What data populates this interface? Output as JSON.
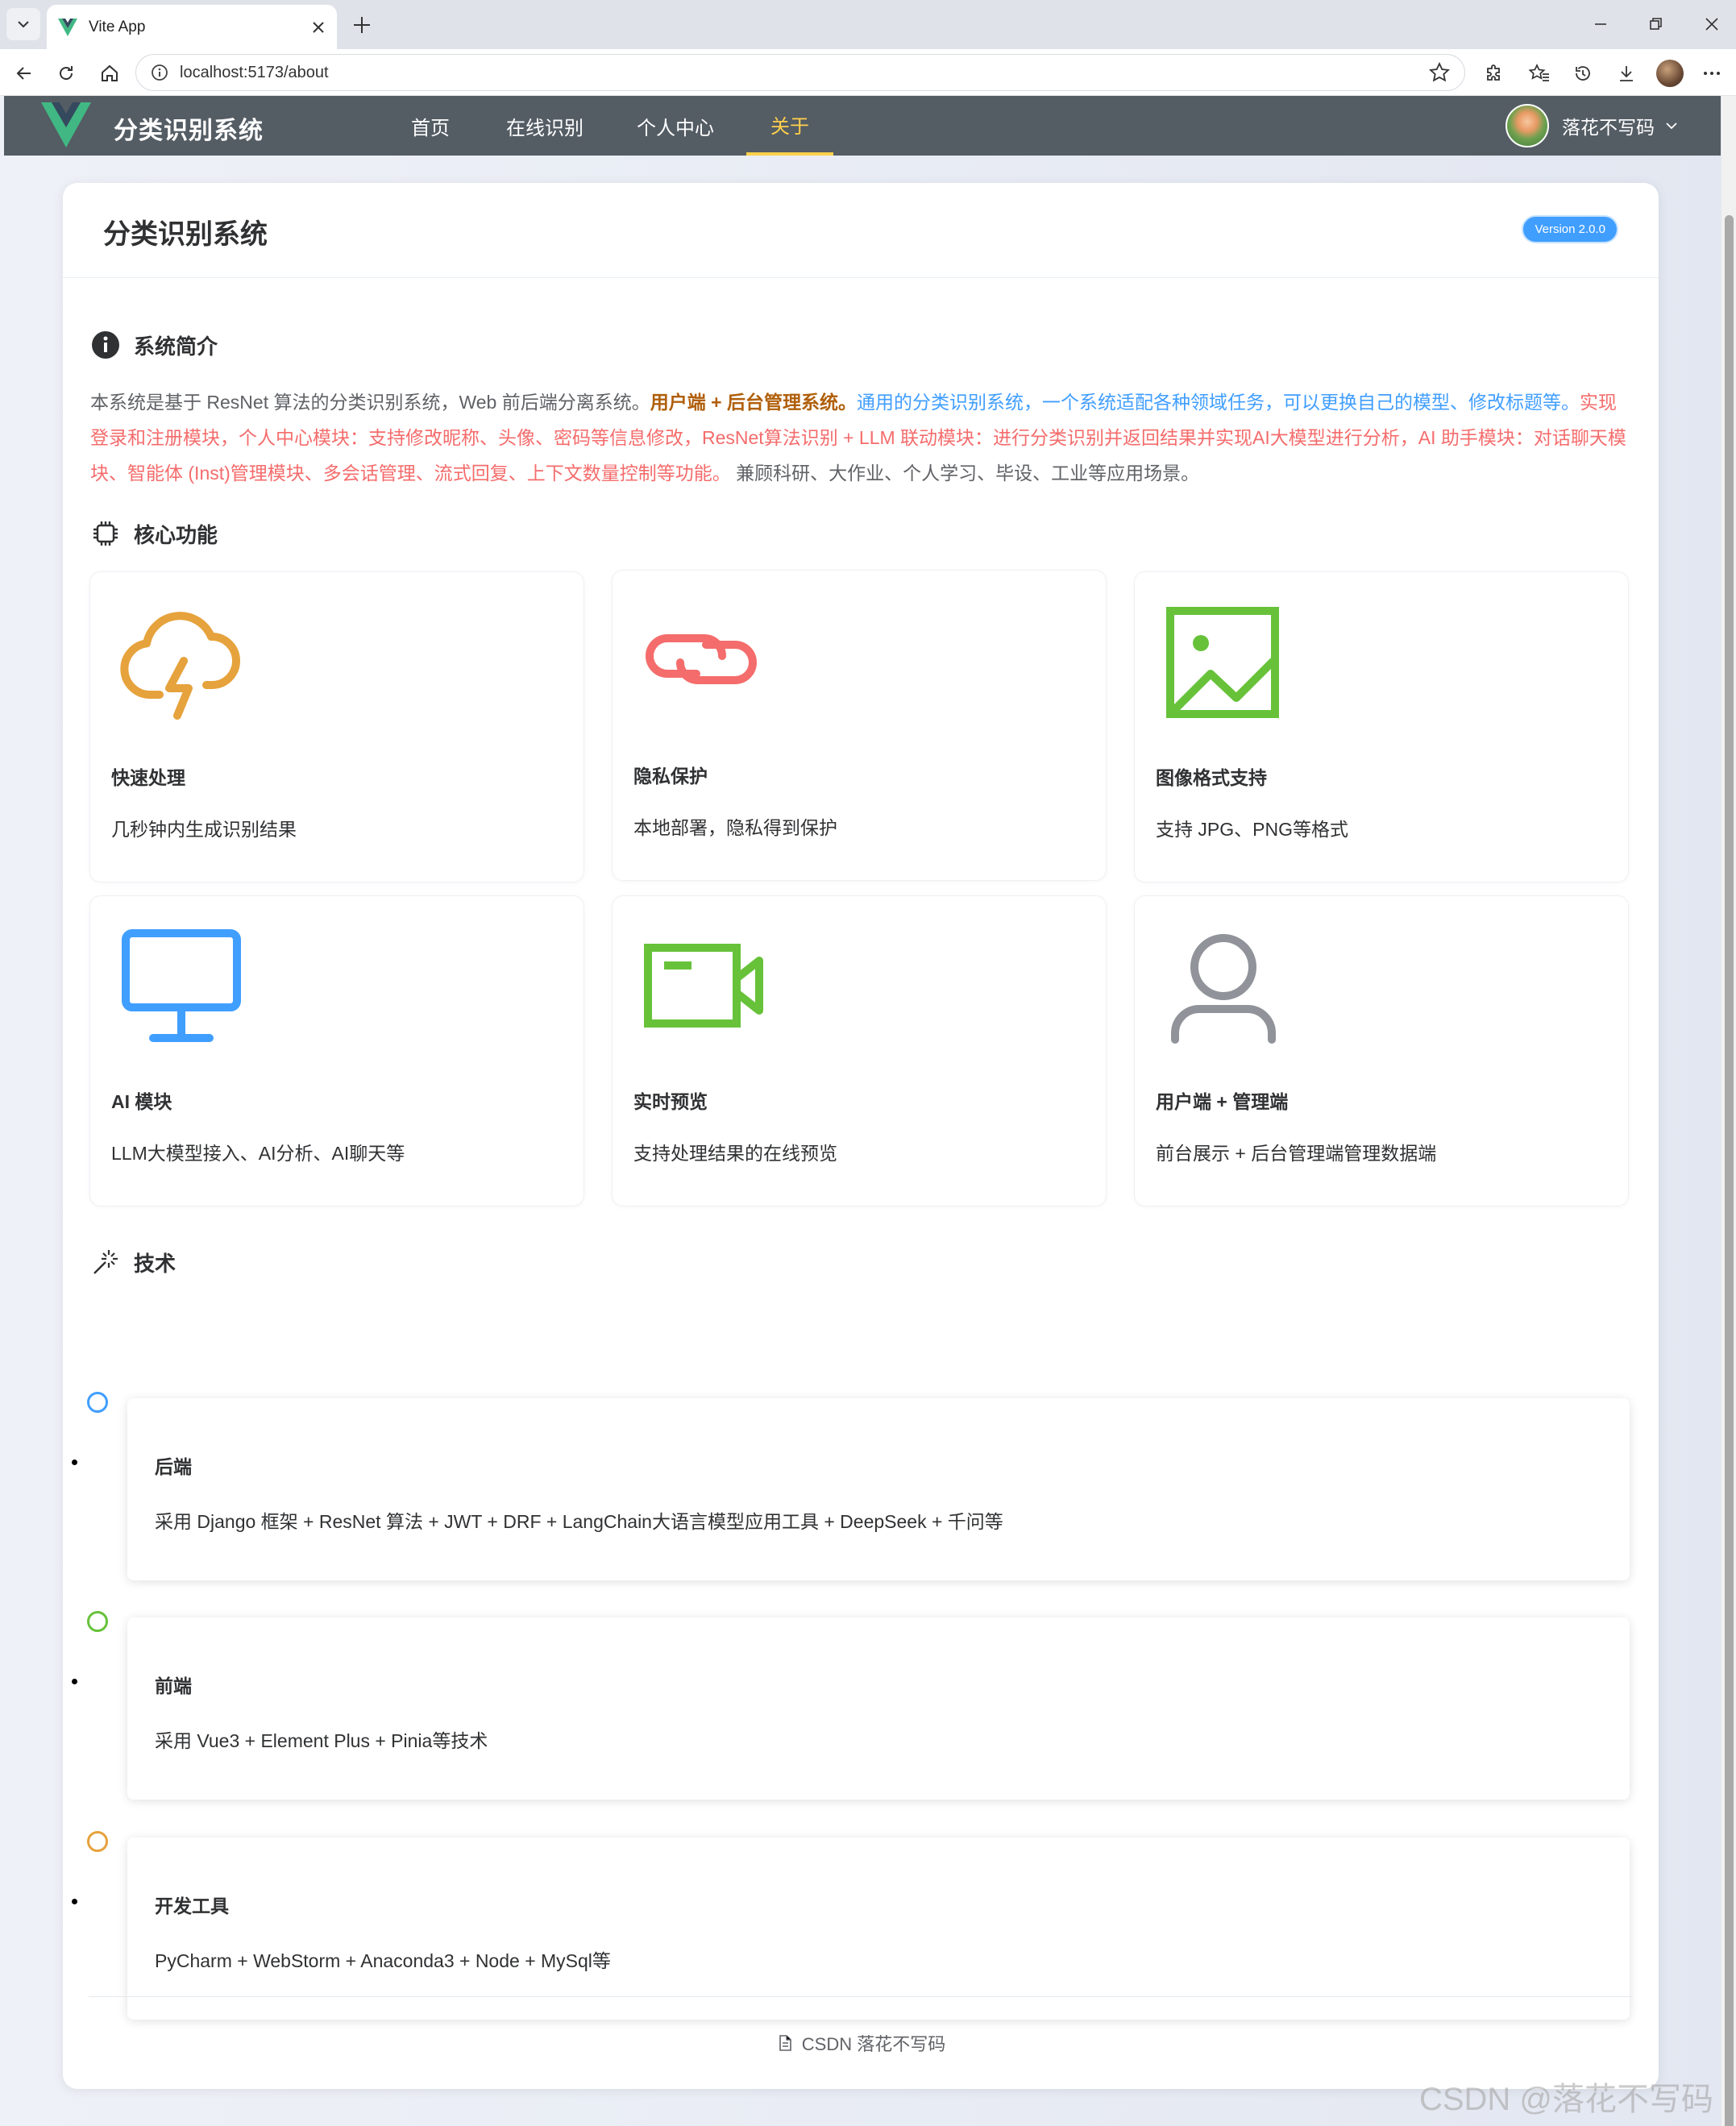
{
  "browser": {
    "tab_title": "Vite App",
    "url": "localhost:5173/about"
  },
  "app": {
    "brand": "分类识别系统",
    "menu": [
      {
        "label": "首页"
      },
      {
        "label": "在线识别"
      },
      {
        "label": "个人中心"
      },
      {
        "label": "关于",
        "active": true
      }
    ],
    "user": {
      "name": "落花不写码"
    }
  },
  "about": {
    "title": "分类识别系统",
    "version": "Version 2.0.0",
    "intro_section": "系统简介",
    "intro": {
      "part1": "本系统是基于 ResNet 算法的分类识别系统，Web 前后端分离系统。",
      "part2": "用户端 + 后台管理系统。",
      "part3": "通用的分类识别系统，一个系统适配各种领域任务，可以更换自己的模型、修改标题等。",
      "part4": "实现 登录和注册模块，个人中心模块：支持修改昵称、头像、密码等信息修改，ResNet算法识别 + LLM 联动模块：进行分类识别并返回结果并实现AI大模型进行分析，AI 助手模块：对话聊天模块、智能体 (Inst)管理模块、多会话管理、流式回复、上下文数量控制等功能。",
      "part5": " 兼顾科研、大作业、个人学习、毕设、工业等应用场景。"
    },
    "features_section": "核心功能",
    "features": [
      {
        "title": "快速处理",
        "desc": "几秒钟内生成识别结果",
        "icon": "cloud-lightning-icon",
        "color": "#e6a23c"
      },
      {
        "title": "隐私保护",
        "desc": "本地部署，隐私得到保护",
        "icon": "link-icon",
        "color": "#f56c6c"
      },
      {
        "title": "图像格式支持",
        "desc": "支持 JPG、PNG等格式",
        "icon": "picture-icon",
        "color": "#67c23a"
      },
      {
        "title": "AI 模块",
        "desc": "LLM大模型接入、AI分析、AI聊天等",
        "icon": "monitor-icon",
        "color": "#409eff"
      },
      {
        "title": "实时预览",
        "desc": "支持处理结果的在线预览",
        "icon": "video-camera-icon",
        "color": "#67c23a"
      },
      {
        "title": "用户端 + 管理端",
        "desc": "前台展示 + 后台管理端管理数据端",
        "icon": "user-icon",
        "color": "#909399"
      }
    ],
    "tech_section": "技术",
    "tech": [
      {
        "title": "后端",
        "desc": "采用 Django 框架 + ResNet 算法 + JWT + DRF + LangChain大语言模型应用工具 + DeepSeek + 千问等",
        "color": "#409eff"
      },
      {
        "title": "前端",
        "desc": "采用 Vue3 + Element Plus + Pinia等技术",
        "color": "#67c23a"
      },
      {
        "title": "开发工具",
        "desc": "PyCharm + WebStorm + Anaconda3 + Node + MySql等",
        "color": "#e6a23c"
      }
    ],
    "footer": "CSDN 落花不写码"
  },
  "watermark": "CSDN @落花不写码"
}
